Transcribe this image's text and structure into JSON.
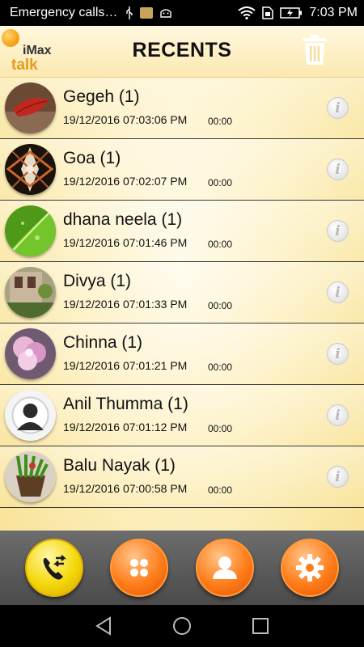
{
  "status_bar": {
    "carrier_text": "Emergency calls…",
    "time": "7:03 PM"
  },
  "header": {
    "logo_primary": "iMax",
    "logo_secondary": "talk",
    "title": "RECENTS"
  },
  "calls": [
    {
      "name": "Gegeh (1)",
      "datetime": "19/12/2016 07:03:06 PM",
      "duration": "00:00"
    },
    {
      "name": "Goa (1)",
      "datetime": "19/12/2016 07:02:07 PM",
      "duration": "00:00"
    },
    {
      "name": "dhana neela (1)",
      "datetime": "19/12/2016 07:01:46 PM",
      "duration": "00:00"
    },
    {
      "name": "Divya (1)",
      "datetime": "19/12/2016 07:01:33 PM",
      "duration": "00:00"
    },
    {
      "name": "Chinna (1)",
      "datetime": "19/12/2016 07:01:21 PM",
      "duration": "00:00"
    },
    {
      "name": "Anil Thumma (1)",
      "datetime": "19/12/2016 07:01:12 PM",
      "duration": "00:00"
    },
    {
      "name": "Balu Nayak (1)",
      "datetime": "19/12/2016 07:00:58 PM",
      "duration": "00:00"
    }
  ],
  "info_glyph": "i",
  "tabs": [
    {
      "icon": "call-transfer-icon",
      "color": "#f4d80a",
      "active": true
    },
    {
      "icon": "dialpad-icon",
      "color": "#ff7d1a",
      "active": false
    },
    {
      "icon": "contact-icon",
      "color": "#ff7d1a",
      "active": false
    },
    {
      "icon": "settings-gear-icon",
      "color": "#ff7d1a",
      "active": false
    }
  ],
  "colors": {
    "accent_yellow": "#f4d80a",
    "accent_orange": "#ff7d1a",
    "background": "#fdf0c2"
  }
}
